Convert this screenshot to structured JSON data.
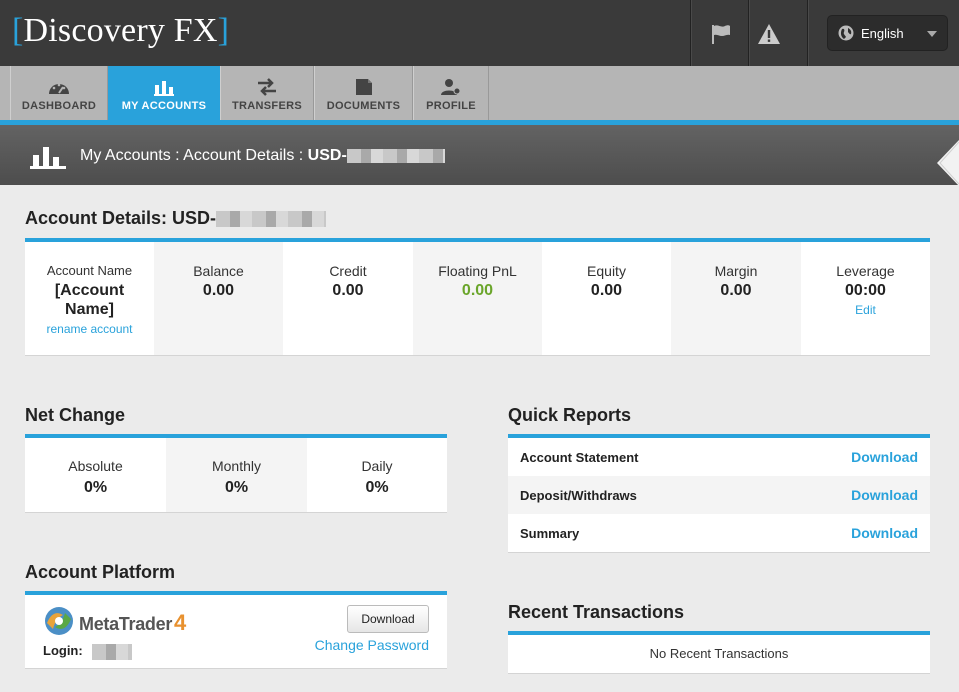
{
  "app": {
    "logo_open": "[",
    "logo_text": "Discovery FX",
    "logo_close": "]",
    "language": "English"
  },
  "nav": {
    "tabs": [
      {
        "label": "DASHBOARD",
        "icon": "gauge-icon"
      },
      {
        "label": "MY ACCOUNTS",
        "icon": "bar-chart-icon",
        "active": true
      },
      {
        "label": "TRANSFERS",
        "icon": "transfer-arrows-icon"
      },
      {
        "label": "DOCUMENTS",
        "icon": "document-icon"
      },
      {
        "label": "PROFILE",
        "icon": "user-icon"
      }
    ]
  },
  "breadcrumb": {
    "path": "My Accounts : Account Details : ",
    "account": "USD-"
  },
  "account_details": {
    "heading": "Account Details: USD-",
    "account_name_label": "Account Name",
    "account_name_value": "[Account Name]",
    "rename_link": "rename account",
    "balance_label": "Balance",
    "balance_value": "0.00",
    "credit_label": "Credit",
    "credit_value": "0.00",
    "floating_label": "Floating PnL",
    "floating_value": "0.00",
    "equity_label": "Equity",
    "equity_value": "0.00",
    "margin_label": "Margin",
    "margin_value": "0.00",
    "leverage_label": "Leverage",
    "leverage_value": "00:00",
    "leverage_edit": "Edit"
  },
  "net_change": {
    "heading": "Net Change",
    "absolute_label": "Absolute",
    "absolute_value": "0%",
    "monthly_label": "Monthly",
    "monthly_value": "0%",
    "daily_label": "Daily",
    "daily_value": "0%"
  },
  "quick_reports": {
    "heading": "Quick Reports",
    "rows": [
      {
        "name": "Account Statement",
        "action": "Download"
      },
      {
        "name": "Deposit/Withdraws",
        "action": "Download"
      },
      {
        "name": "Summary",
        "action": "Download"
      }
    ]
  },
  "platform": {
    "heading": "Account Platform",
    "brand": "MetaTrader",
    "brand_version": "4",
    "download_button": "Download",
    "change_password": "Change Password",
    "login_label": "Login:"
  },
  "recent": {
    "heading": "Recent Transactions",
    "empty": "No Recent Transactions"
  },
  "colors": {
    "accent": "#29a2db",
    "positive": "#6aa52a",
    "topbar": "#3a3a3a"
  }
}
